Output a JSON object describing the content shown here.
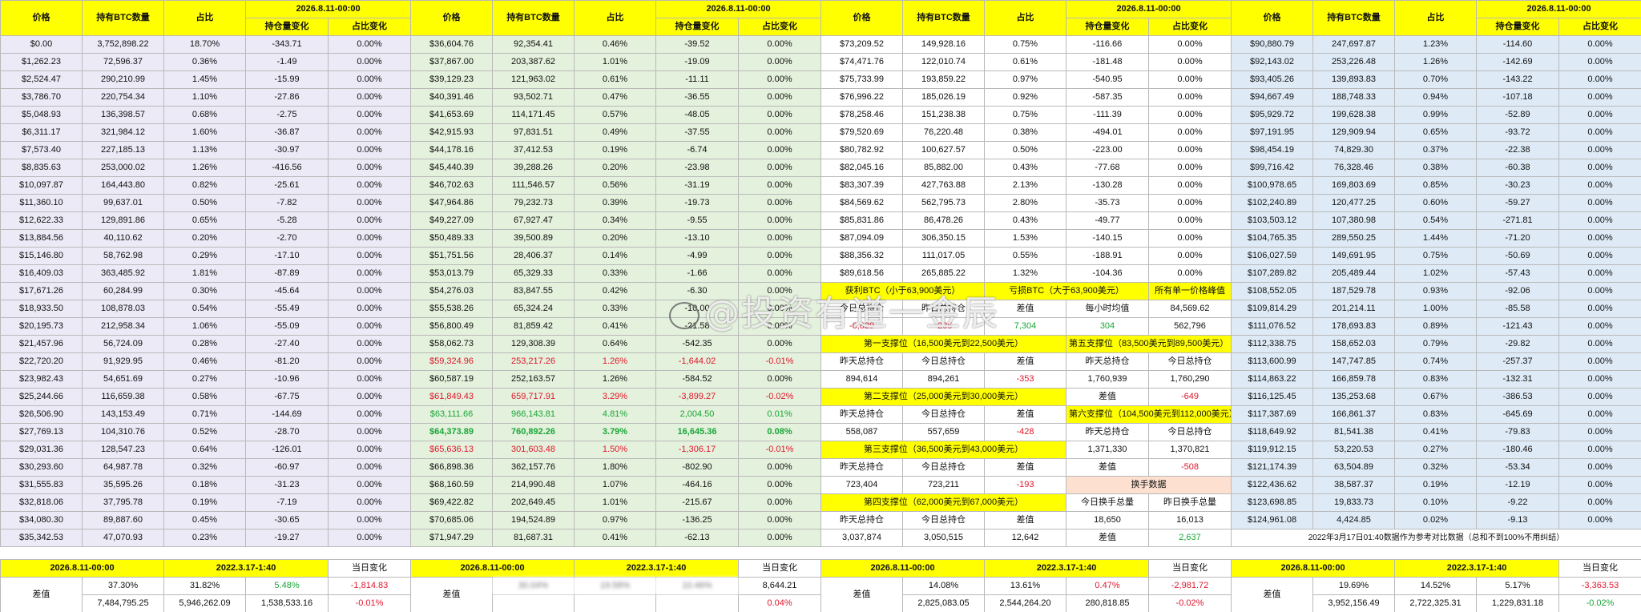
{
  "headers": {
    "price": "价格",
    "btc": "持有BTC数量",
    "pct": "占比",
    "date": "2026.8.11-00:00",
    "chg": "持仓量变化",
    "pctchg": "占比变化"
  },
  "col1_rows": [
    [
      "$0.00",
      "3,752,898.22",
      "18.70%",
      "-343.71",
      "0.00%"
    ],
    [
      "$1,262.23",
      "72,596.37",
      "0.36%",
      "-1.49",
      "0.00%"
    ],
    [
      "$2,524.47",
      "290,210.99",
      "1.45%",
      "-15.99",
      "0.00%"
    ],
    [
      "$3,786.70",
      "220,754.34",
      "1.10%",
      "-27.86",
      "0.00%"
    ],
    [
      "$5,048.93",
      "136,398.57",
      "0.68%",
      "-2.75",
      "0.00%"
    ],
    [
      "$6,311.17",
      "321,984.12",
      "1.60%",
      "-36.87",
      "0.00%"
    ],
    [
      "$7,573.40",
      "227,185.13",
      "1.13%",
      "-30.97",
      "0.00%"
    ],
    [
      "$8,835.63",
      "253,000.02",
      "1.26%",
      "-416.56",
      "0.00%"
    ],
    [
      "$10,097.87",
      "164,443.80",
      "0.82%",
      "-25.61",
      "0.00%"
    ],
    [
      "$11,360.10",
      "99,637.01",
      "0.50%",
      "-7.82",
      "0.00%"
    ],
    [
      "$12,622.33",
      "129,891.86",
      "0.65%",
      "-5.28",
      "0.00%"
    ],
    [
      "$13,884.56",
      "40,110.62",
      "0.20%",
      "-2.70",
      "0.00%"
    ],
    [
      "$15,146.80",
      "58,762.98",
      "0.29%",
      "-17.10",
      "0.00%"
    ],
    [
      "$16,409.03",
      "363,485.92",
      "1.81%",
      "-87.89",
      "0.00%"
    ],
    [
      "$17,671.26",
      "60,284.99",
      "0.30%",
      "-45.64",
      "0.00%"
    ],
    [
      "$18,933.50",
      "108,878.03",
      "0.54%",
      "-55.49",
      "0.00%"
    ],
    [
      "$20,195.73",
      "212,958.34",
      "1.06%",
      "-55.09",
      "0.00%"
    ],
    [
      "$21,457.96",
      "56,724.09",
      "0.28%",
      "-27.40",
      "0.00%"
    ],
    [
      "$22,720.20",
      "91,929.95",
      "0.46%",
      "-81.20",
      "0.00%"
    ],
    [
      "$23,982.43",
      "54,651.69",
      "0.27%",
      "-10.96",
      "0.00%"
    ],
    [
      "$25,244.66",
      "116,659.38",
      "0.58%",
      "-67.75",
      "0.00%"
    ],
    [
      "$26,506.90",
      "143,153.49",
      "0.71%",
      "-144.69",
      "0.00%"
    ],
    [
      "$27,769.13",
      "104,310.76",
      "0.52%",
      "-28.70",
      "0.00%"
    ],
    [
      "$29,031.36",
      "128,547.23",
      "0.64%",
      "-126.01",
      "0.00%"
    ],
    [
      "$30,293.60",
      "64,987.78",
      "0.32%",
      "-60.97",
      "0.00%"
    ],
    [
      "$31,555.83",
      "35,595.26",
      "0.18%",
      "-31.23",
      "0.00%"
    ],
    [
      "$32,818.06",
      "37,795.78",
      "0.19%",
      "-7.19",
      "0.00%"
    ],
    [
      "$34,080.30",
      "89,887.60",
      "0.45%",
      "-30.65",
      "0.00%"
    ],
    [
      "$35,342.53",
      "47,070.93",
      "0.23%",
      "-19.27",
      "0.00%"
    ]
  ],
  "col2_rows": [
    [
      "$36,604.76",
      "92,354.41",
      "0.46%",
      "-39.52",
      "0.00%"
    ],
    [
      "$37,867.00",
      "203,387.62",
      "1.01%",
      "-19.09",
      "0.00%"
    ],
    [
      "$39,129.23",
      "121,963.02",
      "0.61%",
      "-11.11",
      "0.00%"
    ],
    [
      "$40,391.46",
      "93,502.71",
      "0.47%",
      "-36.55",
      "0.00%"
    ],
    [
      "$41,653.69",
      "114,171.45",
      "0.57%",
      "-48.05",
      "0.00%"
    ],
    [
      "$42,915.93",
      "97,831.51",
      "0.49%",
      "-37.55",
      "0.00%"
    ],
    [
      "$44,178.16",
      "37,412.53",
      "0.19%",
      "-6.74",
      "0.00%"
    ],
    [
      "$45,440.39",
      "39,288.26",
      "0.20%",
      "-23.98",
      "0.00%"
    ],
    [
      "$46,702.63",
      "111,546.57",
      "0.56%",
      "-31.19",
      "0.00%"
    ],
    [
      "$47,964.86",
      "79,232.73",
      "0.39%",
      "-19.73",
      "0.00%"
    ],
    [
      "$49,227.09",
      "67,927.47",
      "0.34%",
      "-9.55",
      "0.00%"
    ],
    [
      "$50,489.33",
      "39,500.89",
      "0.20%",
      "-13.10",
      "0.00%"
    ],
    [
      "$51,751.56",
      "28,406.37",
      "0.14%",
      "-4.99",
      "0.00%"
    ],
    [
      "$53,013.79",
      "65,329.33",
      "0.33%",
      "-1.66",
      "0.00%"
    ],
    [
      "$54,276.03",
      "83,847.55",
      "0.42%",
      "-6.30",
      "0.00%"
    ],
    [
      "$55,538.26",
      "65,324.24",
      "0.33%",
      "-10.00",
      "0.00%"
    ],
    [
      "$56,800.49",
      "81,859.42",
      "0.41%",
      "-21.58",
      "0.00%"
    ],
    [
      "$58,062.73",
      "129,308.39",
      "0.64%",
      "-542.35",
      "0.00%"
    ],
    [
      "$59,324.96",
      "253,217.26",
      "1.26%",
      "-1,644.02",
      "-0.01%"
    ],
    [
      "$60,587.19",
      "252,163.57",
      "1.26%",
      "-584.52",
      "0.00%"
    ],
    [
      "$61,849.43",
      "659,717.91",
      "3.29%",
      "-3,899.27",
      "-0.02%"
    ],
    [
      "$63,111.66",
      "966,143.81",
      "4.81%",
      "2,004.50",
      "0.01%"
    ],
    [
      "$64,373.89",
      "760,892.26",
      "3.79%",
      "16,645.36",
      "0.08%"
    ],
    [
      "$65,636.13",
      "301,603.48",
      "1.50%",
      "-1,306.17",
      "-0.01%"
    ],
    [
      "$66,898.36",
      "362,157.76",
      "1.80%",
      "-802.90",
      "0.00%"
    ],
    [
      "$68,160.59",
      "214,990.48",
      "1.07%",
      "-464.16",
      "0.00%"
    ],
    [
      "$69,422.82",
      "202,649.45",
      "1.01%",
      "-215.67",
      "0.00%"
    ],
    [
      "$70,685.06",
      "194,524.89",
      "0.97%",
      "-136.25",
      "0.00%"
    ],
    [
      "$71,947.29",
      "81,687.31",
      "0.41%",
      "-62.13",
      "0.00%"
    ]
  ],
  "col3_rows": [
    [
      "$73,209.52",
      "149,928.16",
      "0.75%",
      "-116.66",
      "0.00%"
    ],
    [
      "$74,471.76",
      "122,010.74",
      "0.61%",
      "-181.48",
      "0.00%"
    ],
    [
      "$75,733.99",
      "193,859.22",
      "0.97%",
      "-540.95",
      "0.00%"
    ],
    [
      "$76,996.22",
      "185,026.19",
      "0.92%",
      "-587.35",
      "0.00%"
    ],
    [
      "$78,258.46",
      "151,238.38",
      "0.75%",
      "-111.39",
      "0.00%"
    ],
    [
      "$79,520.69",
      "76,220.48",
      "0.38%",
      "-494.01",
      "0.00%"
    ],
    [
      "$80,782.92",
      "100,627.57",
      "0.50%",
      "-223.00",
      "0.00%"
    ],
    [
      "$82,045.16",
      "85,882.00",
      "0.43%",
      "-77.68",
      "0.00%"
    ],
    [
      "$83,307.39",
      "427,763.88",
      "2.13%",
      "-130.28",
      "0.00%"
    ],
    [
      "$84,569.62",
      "562,795.73",
      "2.80%",
      "-35.73",
      "0.00%"
    ],
    [
      "$85,831.86",
      "86,478.26",
      "0.43%",
      "-49.77",
      "0.00%"
    ],
    [
      "$87,094.09",
      "306,350.15",
      "1.53%",
      "-140.15",
      "0.00%"
    ],
    [
      "$88,356.32",
      "111,017.05",
      "0.55%",
      "-188.91",
      "0.00%"
    ],
    [
      "$89,618.56",
      "265,885.22",
      "1.32%",
      "-104.36",
      "0.00%"
    ]
  ],
  "col3_extra": {
    "r15": [
      "获利BTC（小于63,900美元）",
      "亏损BTC（大于63,900美元）",
      "所有单一价格峰值"
    ],
    "r16": [
      "今日总持仓",
      "昨日总持仓",
      "差值",
      "持仓",
      "每小时均值",
      "84,569.62"
    ],
    "r17": [
      "-6,829",
      "-285",
      "7,304",
      "304",
      "562,796"
    ],
    "s1": "第一支撑位（16,500美元到22,500美元）",
    "s5": "第五支撑位（83,500美元到89,500美元）",
    "lab_a": [
      "昨天总持仓",
      "今日总持仓",
      "差值",
      "昨天总持仓",
      "今日总持仓"
    ],
    "v1": [
      "894,614",
      "894,261",
      "-353",
      "1,760,939",
      "1,760,290"
    ],
    "s2": "第二支撑位（25,000美元到30,000美元）",
    "diff_lbl": "差值",
    "diff_v5": "-649",
    "s6": "第六支撑位（104,500美元到112,000美元）",
    "v2": [
      "558,087",
      "557,659",
      "-428"
    ],
    "s3": "第三支撑位（36,500美元到43,000美元）",
    "v6": [
      "1,371,330",
      "1,370,821"
    ],
    "lab_c": [
      "昨天总持仓",
      "今日总持仓",
      "差值",
      "差值"
    ],
    "diff_v6": "-508",
    "v3": [
      "723,404",
      "723,211",
      "-193"
    ],
    "swap": "换手数据",
    "s4": "第四支撑位（62,000美元到67,000美元）",
    "swap_lbl": [
      "今日换手总量",
      "昨日换手总量"
    ],
    "lab_d": [
      "昨天总持仓",
      "今日总持仓",
      "差值"
    ],
    "swap_v": [
      "18,650",
      "16,013"
    ],
    "v4": [
      "3,037,874",
      "3,050,515",
      "12,642"
    ],
    "swap_diff": "2,637"
  },
  "col4_rows": [
    [
      "$90,880.79",
      "247,697.87",
      "1.23%",
      "-114.60",
      "0.00%"
    ],
    [
      "$92,143.02",
      "253,226.48",
      "1.26%",
      "-142.69",
      "0.00%"
    ],
    [
      "$93,405.26",
      "139,893.83",
      "0.70%",
      "-143.22",
      "0.00%"
    ],
    [
      "$94,667.49",
      "188,748.33",
      "0.94%",
      "-107.18",
      "0.00%"
    ],
    [
      "$95,929.72",
      "199,628.38",
      "0.99%",
      "-52.89",
      "0.00%"
    ],
    [
      "$97,191.95",
      "129,909.94",
      "0.65%",
      "-93.72",
      "0.00%"
    ],
    [
      "$98,454.19",
      "74,829.30",
      "0.37%",
      "-22.38",
      "0.00%"
    ],
    [
      "$99,716.42",
      "76,328.46",
      "0.38%",
      "-60.38",
      "0.00%"
    ],
    [
      "$100,978.65",
      "169,803.69",
      "0.85%",
      "-30.23",
      "0.00%"
    ],
    [
      "$102,240.89",
      "120,477.25",
      "0.60%",
      "-59.27",
      "0.00%"
    ],
    [
      "$103,503.12",
      "107,380.98",
      "0.54%",
      "-271.81",
      "0.00%"
    ],
    [
      "$104,765.35",
      "289,550.25",
      "1.44%",
      "-71.20",
      "0.00%"
    ],
    [
      "$106,027.59",
      "149,691.95",
      "0.75%",
      "-50.69",
      "0.00%"
    ],
    [
      "$107,289.82",
      "205,489.44",
      "1.02%",
      "-57.43",
      "0.00%"
    ],
    [
      "$108,552.05",
      "187,529.78",
      "0.93%",
      "-92.06",
      "0.00%"
    ],
    [
      "$109,814.29",
      "201,214.11",
      "1.00%",
      "-85.58",
      "0.00%"
    ],
    [
      "$111,076.52",
      "178,693.83",
      "0.89%",
      "-121.43",
      "0.00%"
    ],
    [
      "$112,338.75",
      "158,652.03",
      "0.79%",
      "-29.82",
      "0.00%"
    ],
    [
      "$113,600.99",
      "147,747.85",
      "0.74%",
      "-257.37",
      "0.00%"
    ],
    [
      "$114,863.22",
      "166,859.78",
      "0.83%",
      "-132.31",
      "0.00%"
    ],
    [
      "$116,125.45",
      "135,253.68",
      "0.67%",
      "-386.53",
      "0.00%"
    ],
    [
      "$117,387.69",
      "166,861.37",
      "0.83%",
      "-645.69",
      "0.00%"
    ],
    [
      "$118,649.92",
      "81,541.38",
      "0.41%",
      "-79.83",
      "0.00%"
    ],
    [
      "$119,912.15",
      "53,220.53",
      "0.27%",
      "-180.46",
      "0.00%"
    ],
    [
      "$121,174.39",
      "63,504.89",
      "0.32%",
      "-53.34",
      "0.00%"
    ],
    [
      "$122,436.62",
      "38,587.37",
      "0.19%",
      "-12.19",
      "0.00%"
    ],
    [
      "$123,698.85",
      "19,833.73",
      "0.10%",
      "-9.22",
      "0.00%"
    ],
    [
      "$124,961.08",
      "4,424.85",
      "0.02%",
      "-9.13",
      "0.00%"
    ]
  ],
  "col4_note": "2022年3月17日01:40数据作为参考对比数据（总和不到100%不用纠结）",
  "footer_labels": {
    "d1": "2026.8.11-00:00",
    "d2": "2022.3.17-1:40",
    "chg": "当日变化",
    "diff": "差值"
  },
  "foot1": {
    "r1": [
      "37.30%",
      "31.82%",
      "5.48%",
      "-1,814.83"
    ],
    "r2": [
      "7,484,795.25",
      "5,946,262.09",
      "1,538,533.16",
      "-0.01%"
    ]
  },
  "foot2": {
    "r1": [
      "30.04%",
      "19.58%",
      "10.46%",
      "8,644.21"
    ],
    "r2": [
      "",
      "",
      "",
      "0.04%"
    ]
  },
  "foot3": {
    "r1": [
      "14.08%",
      "13.61%",
      "0.47%",
      "-2,981.72"
    ],
    "r2": [
      "2,825,083.05",
      "2,544,264.20",
      "280,818.85",
      "-0.02%"
    ]
  },
  "foot4": {
    "r1": [
      "19.69%",
      "14.52%",
      "5.17%",
      "-3,363.53"
    ],
    "r2": [
      "3,952,156.49",
      "2,722,325.31",
      "1,229,831.18",
      "-0.02%"
    ]
  },
  "watermark": "@投资有道一金辰",
  "colors": {
    "header": "#ffff00",
    "purple": "#eceaf7",
    "green": "#e4f1dc",
    "blue": "#deebf7",
    "red": "#e0182d",
    "pos": "#19a538"
  }
}
